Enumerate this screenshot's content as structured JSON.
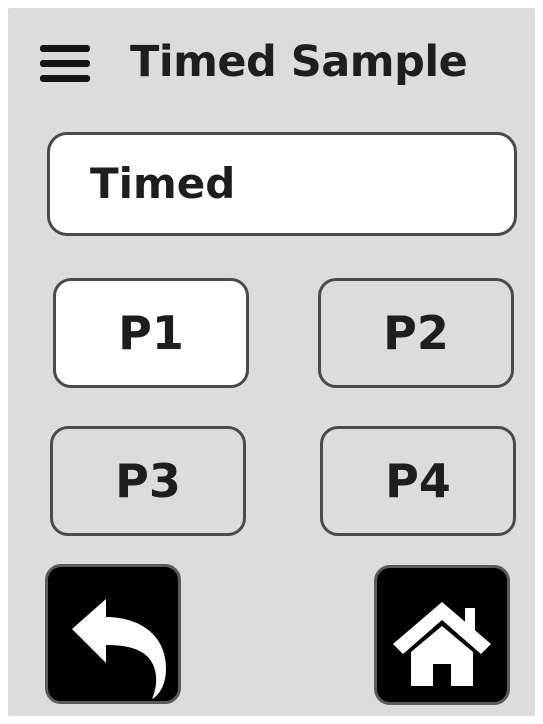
{
  "header": {
    "menu_icon": "hamburger-menu-icon",
    "title": "Timed Sample"
  },
  "mode_field": {
    "value": "Timed"
  },
  "presets": [
    {
      "label": "P1",
      "selected": true
    },
    {
      "label": "P2",
      "selected": false
    },
    {
      "label": "P3",
      "selected": false
    },
    {
      "label": "P4",
      "selected": false
    }
  ],
  "footer": {
    "back_icon": "back-arrow-icon",
    "home_icon": "home-icon"
  },
  "colors": {
    "background": "#dcdcdc",
    "selected_button": "#ffffff",
    "icon_button": "#000000",
    "text": "#1e1e1e"
  }
}
